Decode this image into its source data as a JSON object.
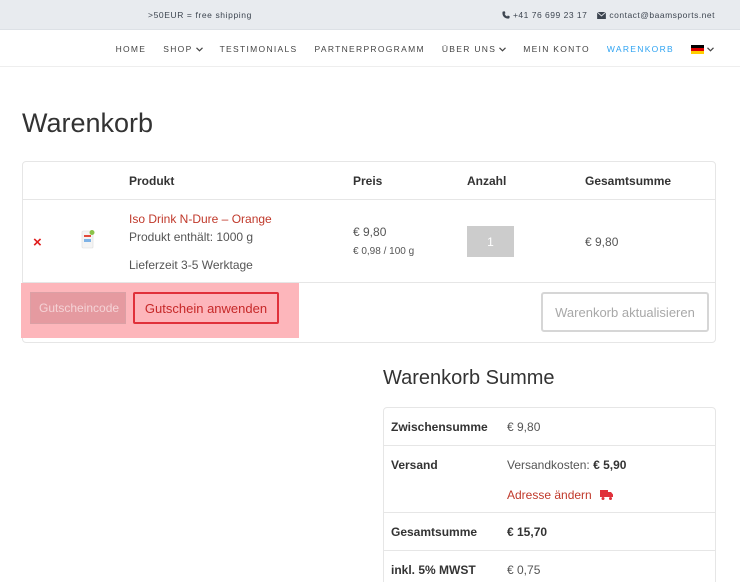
{
  "topbar": {
    "promo": ">50EUR = free shipping",
    "phone": "+41 76 699 23 17",
    "email": "contact@baamsports.net"
  },
  "nav": {
    "items": [
      {
        "label": "HOME"
      },
      {
        "label": "SHOP"
      },
      {
        "label": "TESTIMONIALS"
      },
      {
        "label": "PARTNERPROGRAMM"
      },
      {
        "label": "ÜBER UNS"
      },
      {
        "label": "MEIN KONTO"
      },
      {
        "label": "WARENKORB"
      }
    ],
    "active_color": "#2ea3f2"
  },
  "page": {
    "title": "Warenkorb"
  },
  "cart": {
    "columns": {
      "product": "Produkt",
      "price": "Preis",
      "quantity": "Anzahl",
      "total": "Gesamtsumme"
    },
    "items": [
      {
        "remove": "×",
        "name": "Iso Drink N-Dure – Orange",
        "content": "Produkt enthält: 1000 g",
        "delivery": "Lieferzeit 3-5 Werktage",
        "price": "€ 9,80",
        "unit_price": "€ 0,98 / 100 g",
        "quantity": "1",
        "total": "€ 9,80"
      }
    ],
    "coupon_placeholder": "Gutscheincode",
    "apply_coupon": "Gutschein anwenden",
    "update_cart": "Warenkorb aktualisieren"
  },
  "totals": {
    "title": "Warenkorb Summe",
    "subtotal_label": "Zwischensumme",
    "subtotal_value": "€ 9,80",
    "shipping_label": "Versand",
    "shipping_prefix": "Versandkosten:",
    "shipping_value": "€ 5,90",
    "change_address": "Adresse ändern",
    "total_label": "Gesamtsumme",
    "total_value": "€ 15,70",
    "vat_label": "inkl. 5% MWST",
    "vat_value": "€ 0,75"
  },
  "colors": {
    "accent_red": "#c0392b",
    "remove_red": "#e01d1d",
    "highlight": "#fdb6bb"
  }
}
